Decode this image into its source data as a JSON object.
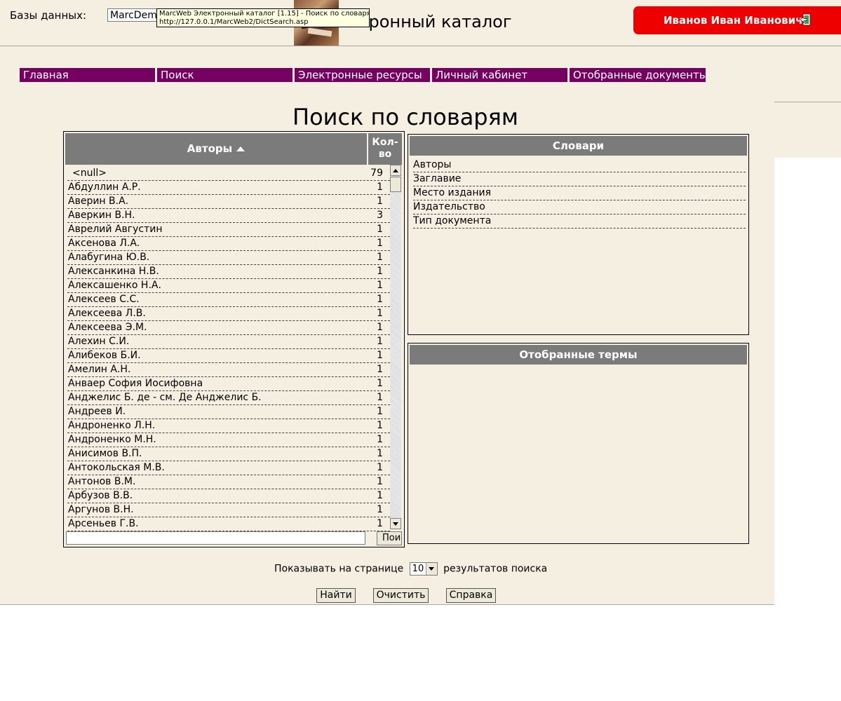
{
  "header": {
    "db_label": "Базы данных:",
    "db_value": "MarcDemo",
    "app_title": "ктронный каталог",
    "tooltip_line1": "MarcWeb Электронный каталог [1.15] - Поиск по словарям",
    "tooltip_line2": "http://127.0.0.1/MarcWeb2/DictSearch.asp",
    "user_name": "Иванов Иван Иванович"
  },
  "colors": {
    "background": "#f5efe2",
    "nav": "#760061",
    "user_box": "#ee0000",
    "table_header": "#7b7b7b"
  },
  "nav": {
    "items": [
      {
        "label": "Главная"
      },
      {
        "label": "Поиск"
      },
      {
        "label": "Электронные ресурсы"
      },
      {
        "label": "Личный кабинет"
      },
      {
        "label": "Отобранные документы"
      }
    ]
  },
  "page_title": "Поиск по словарям",
  "authors": {
    "header_authors": "Авторы",
    "header_count_line1": "Кол-",
    "header_count_line2": "во",
    "search_button": "Поиск",
    "rows": [
      {
        "name": "<null>",
        "count": "79"
      },
      {
        "name": "Абдуллин А.Р.",
        "count": "1"
      },
      {
        "name": "Аверин В.А.",
        "count": "1"
      },
      {
        "name": "Аверкин В.Н.",
        "count": "3"
      },
      {
        "name": "Аврелий Августин",
        "count": "1"
      },
      {
        "name": "Аксенова Л.А.",
        "count": "1"
      },
      {
        "name": "Алабугина Ю.В.",
        "count": "1"
      },
      {
        "name": "Алексанкина Н.В.",
        "count": "1"
      },
      {
        "name": "Алексашенко Н.А.",
        "count": "1"
      },
      {
        "name": "Алексеев С.С.",
        "count": "1"
      },
      {
        "name": "Алексеева Л.В.",
        "count": "1"
      },
      {
        "name": "Алексеева Э.М.",
        "count": "1"
      },
      {
        "name": "Алехин С.И.",
        "count": "1"
      },
      {
        "name": "Алибеков Б.И.",
        "count": "1"
      },
      {
        "name": "Амелин А.Н.",
        "count": "1"
      },
      {
        "name": "Анваер София Иосифовна",
        "count": "1"
      },
      {
        "name": "Анджелис Б. де - см. Де Анджелис Б.",
        "count": "1"
      },
      {
        "name": "Андреев И.",
        "count": "1"
      },
      {
        "name": "Андроненко Л.Н.",
        "count": "1"
      },
      {
        "name": "Андроненко М.Н.",
        "count": "1"
      },
      {
        "name": "Анисимов В.П.",
        "count": "1"
      },
      {
        "name": "Антокольская М.В.",
        "count": "1"
      },
      {
        "name": "Антонов В.М.",
        "count": "1"
      },
      {
        "name": "Арбузов В.В.",
        "count": "1"
      },
      {
        "name": "Аргунов В.Н.",
        "count": "1"
      },
      {
        "name": "Арсеньев Г.В.",
        "count": "1"
      }
    ]
  },
  "dictionaries": {
    "title": "Словари",
    "items": [
      "Авторы",
      "Заглавие",
      "Место издания",
      "Издательство",
      "Тип документа"
    ]
  },
  "selected_terms": {
    "title": "Отобранные термы"
  },
  "paging": {
    "prefix": "Показывать на странице",
    "value": "10",
    "suffix": "результатов поиска"
  },
  "buttons": {
    "find": "Найти",
    "clear": "Очистить",
    "help": "Справка"
  }
}
